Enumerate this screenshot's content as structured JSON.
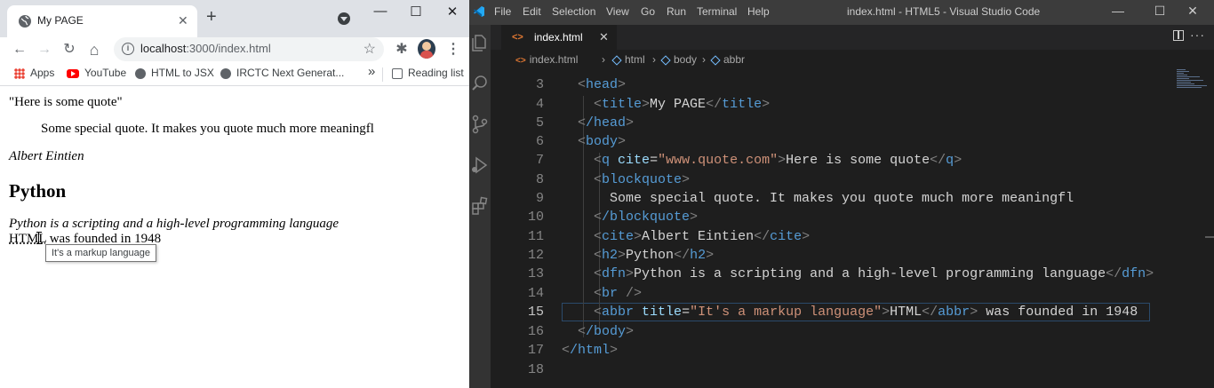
{
  "chrome": {
    "tab_title": "My PAGE",
    "tab_close": "✕",
    "new_tab": "+",
    "window_controls": {
      "minimize": "—",
      "maximize": "☐",
      "close": "✕"
    },
    "toolbar": {
      "back": "←",
      "forward": "→",
      "reload": "↻",
      "home": "⌂",
      "menu": "⋮",
      "extensions": "✱"
    },
    "url_host": "localhost",
    "url_rest": ":3000/index.html",
    "info_icon": "i",
    "star": "☆",
    "bookmarks": [
      {
        "label": "Apps",
        "icon": "apps-grid-icon"
      },
      {
        "label": "YouTube",
        "icon": "youtube-icon"
      },
      {
        "label": "HTML to JSX",
        "icon": "globe-icon"
      },
      {
        "label": "IRCTC Next Generat...",
        "icon": "globe-icon"
      }
    ],
    "bookmarks_overflow": "»",
    "reading_list": "Reading list"
  },
  "page": {
    "quote": "\"Here is some quote\"",
    "blockquote": "Some special quote. It makes you quote much more meaningfl",
    "cite": "Albert Eintien",
    "heading": "Python",
    "dfn": "Python is a scripting and a high-level programming language",
    "abbr": "HTML",
    "abbr_rest": " was founded in 1948",
    "tooltip": "It's a markup language"
  },
  "vscode": {
    "menu": [
      "File",
      "Edit",
      "Selection",
      "View",
      "Go",
      "Run",
      "Terminal",
      "Help"
    ],
    "window_title": "index.html - HTML5 - Visual Studio Code",
    "window_controls": {
      "minimize": "—",
      "maximize": "☐",
      "close": "✕"
    },
    "tab": {
      "icon": "<>",
      "name": "index.html",
      "close": "✕"
    },
    "more": "···",
    "breadcrumb": [
      "index.html",
      "html",
      "body",
      "abbr"
    ],
    "breadcrumb_sep": "›",
    "line_numbers": [
      "3",
      "4",
      "5",
      "6",
      "7",
      "8",
      "9",
      "10",
      "11",
      "12",
      "13",
      "14",
      "15",
      "16",
      "17",
      "18"
    ],
    "current_line": "15",
    "lines": {
      "l3": {
        "tag": "head"
      },
      "l4": {
        "open": "title",
        "text": "My PAGE",
        "close": "title"
      },
      "l5": {
        "tag": "/head"
      },
      "l6": {
        "tag": "body"
      },
      "l7": {
        "open": "q",
        "attr": "cite",
        "value": "\"www.quote.com\"",
        "text": "Here is some quote",
        "close": "q"
      },
      "l8": {
        "tag": "blockquote"
      },
      "l9": {
        "text": "Some special quote. It makes you quote much more meaningfl"
      },
      "l10": {
        "tag": "/blockquote"
      },
      "l11": {
        "open": "cite",
        "text": "Albert Eintien",
        "close": "cite"
      },
      "l12": {
        "open": "h2",
        "text": "Python",
        "close": "h2"
      },
      "l13": {
        "open": "dfn",
        "text": "Python is a scripting and a high-level programming language",
        "close": "dfn"
      },
      "l14": {
        "tag": "br",
        "selfclose": " /"
      },
      "l15": {
        "open": "abbr",
        "attr": "title",
        "value": "\"It's a markup language\"",
        "text": "HTML",
        "close": "abbr",
        "after": " was founded in 1948"
      },
      "l16": {
        "tag": "/body"
      },
      "l17": {
        "tag": "/html"
      }
    }
  },
  "colors": {
    "vscode_bg": "#1e1e1e",
    "tag": "#569cd6",
    "attr": "#9cdcfe",
    "string": "#ce9178",
    "chrome_bg": "#dee1e6"
  }
}
